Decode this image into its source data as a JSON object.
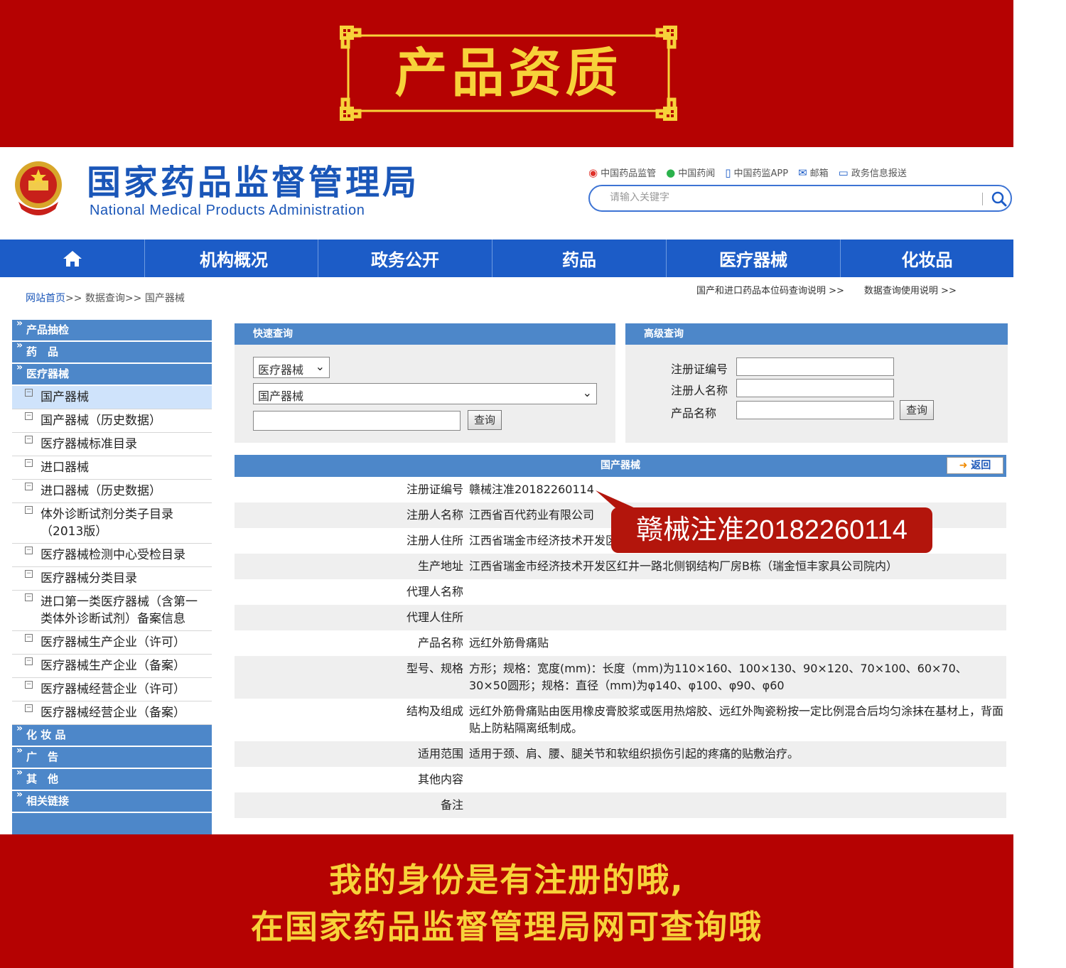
{
  "banner": {
    "title": "产品资质",
    "bottom_line1": "我的身份是有注册的哦,",
    "bottom_line2": "在国家药品监督管理局网可查询哦"
  },
  "header": {
    "title": "国家药品监督管理局",
    "subtitle": "National Medical Products Administration",
    "top_links": [
      {
        "label": "中国药品监管",
        "icon": "weibo-icon"
      },
      {
        "label": "中国药闻",
        "icon": "wechat-icon"
      },
      {
        "label": "中国药监APP",
        "icon": "phone-icon"
      },
      {
        "label": "邮箱",
        "icon": "mail-icon"
      },
      {
        "label": "政务信息报送",
        "icon": "monitor-icon"
      }
    ],
    "search_placeholder": "请输入关键字"
  },
  "nav": {
    "items": [
      "机构概况",
      "政务公开",
      "药品",
      "医疗器械",
      "化妆品"
    ]
  },
  "breadcrumb": {
    "home": "网站首页",
    "path": ">> 数据查询>> 国产器械"
  },
  "help_links": [
    "国产和进口药品本位码查询说明 >>",
    "数据查询使用说明 >>"
  ],
  "sidebar": {
    "categories": {
      "sampling": "产品抽检",
      "drugs": "药　品",
      "devices": "医疗器械",
      "cosmetics": "化 妆 品",
      "ads": "广　告",
      "other": "其　他",
      "links": "相关链接"
    },
    "items": [
      "国产器械",
      "国产器械（历史数据）",
      "医疗器械标准目录",
      "进口器械",
      "进口器械（历史数据）",
      "体外诊断试剂分类子目录（2013版）",
      "医疗器械检测中心受检目录",
      "医疗器械分类目录",
      "进口第一类医疗器械（含第一类体外诊断试剂）备案信息",
      "医疗器械生产企业（许可）",
      "医疗器械生产企业（备案）",
      "医疗器械经营企业（许可）",
      "医疗器械经营企业（备案）"
    ]
  },
  "quick_query": {
    "title": "快速查询",
    "select1": "医疗器械",
    "select2": "国产器械",
    "button": "查询"
  },
  "advanced_query": {
    "title": "高级查询",
    "fields": [
      "注册证编号",
      "注册人名称",
      "产品名称"
    ],
    "button": "查询"
  },
  "detail": {
    "title": "国产器械",
    "back_label": "返回",
    "rows": [
      {
        "label": "注册证编号",
        "value": "赣械注准20182260114"
      },
      {
        "label": "注册人名称",
        "value": "江西省百代药业有限公司"
      },
      {
        "label": "注册人住所",
        "value": "江西省瑞金市经济技术开发区红井一路北侧钢结构厂房B栋（瑞金恒丰家具公司院内）"
      },
      {
        "label": "生产地址",
        "value": "江西省瑞金市经济技术开发区红井一路北侧钢结构厂房B栋（瑞金恒丰家具公司院内）"
      },
      {
        "label": "代理人名称",
        "value": ""
      },
      {
        "label": "代理人住所",
        "value": ""
      },
      {
        "label": "产品名称",
        "value": "远红外筋骨痛贴"
      },
      {
        "label": "型号、规格",
        "value": "方形；规格：宽度(mm)：长度（mm)为110×160、100×130、90×120、70×100、60×70、30×50圆形；规格：直径（mm)为φ140、φ100、φ90、φ60"
      },
      {
        "label": "结构及组成",
        "value": "远红外筋骨痛贴由医用橡皮膏胶浆或医用热熔胶、远红外陶瓷粉按一定比例混合后均匀涂抹在基材上，背面贴上防粘隔离纸制成。"
      },
      {
        "label": "适用范围",
        "value": "适用于颈、肩、腰、腿关节和软组织损伤引起的疼痛的贴敷治疗。"
      },
      {
        "label": "其他内容",
        "value": ""
      },
      {
        "label": "备注",
        "value": ""
      }
    ]
  },
  "callout": {
    "text": "赣械注准20182260114"
  },
  "colors": {
    "banner_red": "#b50202",
    "banner_gold": "#f7d23a",
    "nav_blue": "#1c5cc7",
    "panel_blue": "#4d87c9",
    "title_blue": "#1a56b8"
  }
}
